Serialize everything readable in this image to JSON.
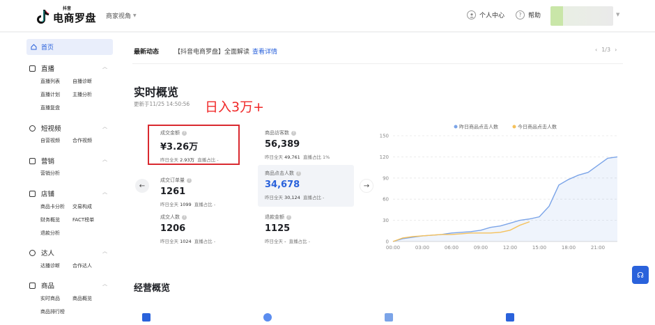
{
  "header": {
    "logo_small": "抖音",
    "logo_main": "电商罗盘",
    "view_switch": "商家视角",
    "personal_center": "个人中心",
    "help": "帮助"
  },
  "sidebar": {
    "home": "首页",
    "sections": [
      {
        "label": "直播",
        "items": [
          "直播列表",
          "自播诊断",
          "直播计划",
          "主播分析",
          "直播复盘"
        ]
      },
      {
        "label": "短视频",
        "items": [
          "自营视频",
          "合作视频"
        ]
      },
      {
        "label": "营销",
        "items": [
          "营销分析"
        ]
      },
      {
        "label": "店铺",
        "items": [
          "商品卡分析",
          "交易构成",
          "财务概览",
          "FACT榜单",
          "退款分析"
        ]
      },
      {
        "label": "达人",
        "items": [
          "达播诊断",
          "合作达人"
        ]
      },
      {
        "label": "商品",
        "items": [
          "实时商品",
          "商品概览",
          "商品排行榜"
        ]
      }
    ]
  },
  "news": {
    "title": "最新动态",
    "body": "【抖音电商罗盘】全面解读",
    "link": "查看详情",
    "pager": "1/3"
  },
  "realtime": {
    "title": "实时概览",
    "updated": "更新于11/25 14:50:56",
    "overlay_text": "日入3万+",
    "metrics": [
      {
        "label": "成交金额",
        "value": "¥3.26万",
        "sub_a_label": "昨日全天",
        "sub_a_value": "2.93万",
        "sub_b": "直播占比 -"
      },
      {
        "label": "商品访客数",
        "value": "56,389",
        "sub_a_label": "昨日全天",
        "sub_a_value": "49,761",
        "sub_b": "直播占比 1%"
      },
      {
        "label": "成交订单量",
        "value": "1261",
        "sub_a_label": "昨日全天",
        "sub_a_value": "1099",
        "sub_b": "直播占比 -"
      },
      {
        "label": "商品点击人数",
        "value": "34,678",
        "sub_a_label": "昨日全天",
        "sub_a_value": "30,124",
        "sub_b": "直播占比 -"
      },
      {
        "label": "成交人数",
        "value": "1206",
        "sub_a_label": "昨日全天",
        "sub_a_value": "1024",
        "sub_b": "直播占比 -"
      },
      {
        "label": "退款金额",
        "value": "1125",
        "sub_a_label": "昨日全天",
        "sub_a_value": "-",
        "sub_b": "直播占比 -"
      }
    ]
  },
  "business": {
    "title": "经营概览"
  },
  "colors": {
    "accent": "#2a62db",
    "series_yesterday": "#7ba4e8",
    "series_today": "#f5c15b",
    "highlight_red": "#d9292f"
  },
  "chart_data": {
    "type": "line",
    "x": [
      "00:00",
      "01:00",
      "02:00",
      "03:00",
      "04:00",
      "05:00",
      "06:00",
      "07:00",
      "08:00",
      "09:00",
      "10:00",
      "11:00",
      "12:00",
      "13:00",
      "14:00",
      "15:00",
      "16:00",
      "17:00",
      "18:00",
      "19:00",
      "20:00",
      "21:00",
      "22:00",
      "23:00"
    ],
    "x_ticks": [
      "00:00",
      "03:00",
      "06:00",
      "09:00",
      "12:00",
      "15:00",
      "18:00",
      "21:00"
    ],
    "y_ticks": [
      0,
      30,
      60,
      90,
      120,
      150
    ],
    "ylim": [
      0,
      150
    ],
    "legend_position": "top",
    "series": [
      {
        "name": "昨日商品点击人数",
        "color": "#7ba4e8",
        "values": [
          0,
          4,
          6,
          8,
          9,
          10,
          12,
          13,
          14,
          16,
          20,
          22,
          26,
          30,
          32,
          35,
          50,
          80,
          88,
          94,
          98,
          108,
          118,
          120
        ]
      },
      {
        "name": "今日商品点击人数",
        "color": "#f5c15b",
        "values": [
          0,
          5,
          7,
          8,
          9,
          10,
          10,
          11,
          12,
          12,
          12,
          13,
          16,
          23,
          28
        ]
      }
    ]
  }
}
